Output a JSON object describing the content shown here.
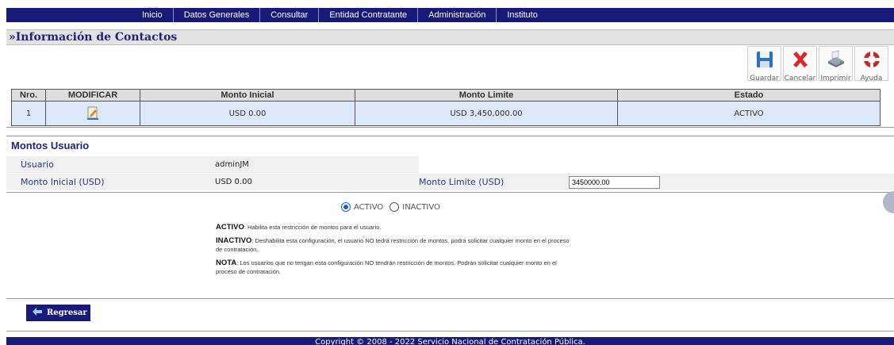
{
  "nav": {
    "items": [
      "Inicio",
      "Datos Generales",
      "Consultar",
      "Entidad Contratante",
      "Administración",
      "Instituto"
    ]
  },
  "page": {
    "title": "»Información de Contactos"
  },
  "toolbar": {
    "buttons": [
      {
        "label": "Guardar",
        "icon": "save-icon"
      },
      {
        "label": "Cancelar",
        "icon": "cancel-icon"
      },
      {
        "label": "Imprimir",
        "icon": "print-icon"
      },
      {
        "label": "Ayuda",
        "icon": "help-icon"
      }
    ]
  },
  "table": {
    "headers": [
      "Nro.",
      "MODIFICAR",
      "Monto Inicial",
      "Monto Limite",
      "Estado"
    ],
    "rows": [
      {
        "nro": "1",
        "modificar_icon": "edit-icon",
        "monto_inicial": "USD 0.00",
        "monto_limite": "USD 3,450,000.00",
        "estado": "ACTIVO"
      }
    ]
  },
  "section": {
    "title": "Montos Usuario",
    "usuario_label": "Usuario",
    "usuario_value": "adminJM",
    "monto_inicial_label": "Monto Inicial (USD)",
    "monto_inicial_value": "USD 0.00",
    "monto_limite_label": "Monto Limite (USD)",
    "monto_limite_value": "3450000.00",
    "radio_activo": "ACTIVO",
    "radio_inactivo": "INACTIVO",
    "selected": "ACTIVO"
  },
  "notes": {
    "activo_title": "ACTIVO",
    "activo_text": ": Habilita esta restricción de montos para el usuario.",
    "inactivo_title": "INACTIVO",
    "inactivo_text": ": Deshabilita esta configuración, el usuario NO tedrá restricción de montos, podrá solicitar cualquier monto en el proceso de contratación.",
    "nota_title": "NOTA",
    "nota_text": ": Los usuarios que no tengan esta configuración NO tendrán restricción de montos. Podrán solicitar cualquier monto en el proceso de contratación."
  },
  "back_button": {
    "label": "Regresar",
    "icon": "arrow-left-icon"
  },
  "footer": {
    "text": "Copyright © 2008 - 2022 Servicio Nacional de Contratación Pública."
  },
  "colors": {
    "nav_bg": "#19197a",
    "title_color": "#22227a",
    "row_bg": "#dde8f8",
    "cancel_red": "#d82a2a"
  }
}
